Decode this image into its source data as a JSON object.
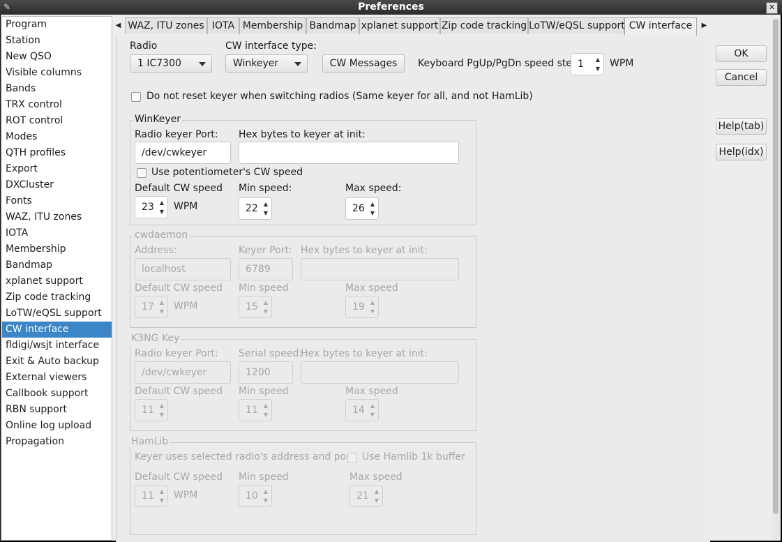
{
  "window": {
    "title": "Preferences",
    "close_glyph": "✕",
    "app_icon": "feather-icon"
  },
  "sidebar": {
    "items": [
      {
        "label": "Program"
      },
      {
        "label": "Station"
      },
      {
        "label": "New QSO"
      },
      {
        "label": "Visible columns"
      },
      {
        "label": "Bands"
      },
      {
        "label": "TRX control"
      },
      {
        "label": "ROT control"
      },
      {
        "label": "Modes"
      },
      {
        "label": "QTH profiles"
      },
      {
        "label": "Export"
      },
      {
        "label": "DXCluster"
      },
      {
        "label": "Fonts"
      },
      {
        "label": "WAZ, ITU zones"
      },
      {
        "label": "IOTA"
      },
      {
        "label": "Membership"
      },
      {
        "label": "Bandmap"
      },
      {
        "label": "xplanet support"
      },
      {
        "label": "Zip code tracking"
      },
      {
        "label": "LoTW/eQSL support"
      },
      {
        "label": "CW interface"
      },
      {
        "label": "fldigi/wsjt interface"
      },
      {
        "label": "Exit & Auto backup"
      },
      {
        "label": "External viewers"
      },
      {
        "label": "Callbook support"
      },
      {
        "label": "RBN support"
      },
      {
        "label": "Online log upload"
      },
      {
        "label": "Propagation"
      }
    ],
    "selected": "CW interface"
  },
  "tabs": {
    "items": [
      {
        "label": "WAZ, ITU zones"
      },
      {
        "label": "IOTA"
      },
      {
        "label": "Membership"
      },
      {
        "label": "Bandmap"
      },
      {
        "label": "xplanet support"
      },
      {
        "label": "Zip code tracking"
      },
      {
        "label": "LoTW/eQSL support"
      },
      {
        "label": "CW interface"
      }
    ],
    "active": "CW interface",
    "left_arrow": "◀",
    "right_arrow": "▶"
  },
  "cw": {
    "radio_label": "Radio",
    "radio_value": "1 IC7300",
    "type_label": "CW interface type:",
    "type_value": "Winkeyer",
    "messages_button": "CW Messages",
    "speed_step_label": "Keyboard PgUp/PgDn speed step",
    "speed_step_value": "1",
    "speed_step_unit": "WPM",
    "no_reset_label": "Do not reset keyer when switching radios (Same keyer for all, and not HamLib)",
    "no_reset_checked": false
  },
  "winkeyer": {
    "title": "WinKeyer",
    "port_label": "Radio keyer Port:",
    "port_value": "/dev/cwkeyer",
    "hex_label": "Hex bytes to keyer at init:",
    "hex_value": "",
    "pot_label": "Use potentiometer's CW speed",
    "pot_checked": false,
    "default_label": "Default CW speed",
    "default_value": "23",
    "unit": "WPM",
    "min_label": "Min speed:",
    "min_value": "22",
    "max_label": "Max speed:",
    "max_value": "26"
  },
  "cwdaemon": {
    "title": "cwdaemon",
    "address_label": "Address:",
    "address_value": "localhost",
    "port_label": "Keyer Port:",
    "port_value": "6789",
    "hex_label": "Hex bytes to keyer at init:",
    "default_label": "Default CW speed",
    "default_value": "17",
    "unit": "WPM",
    "min_label": "Min speed",
    "min_value": "15",
    "max_label": "Max speed",
    "max_value": "19"
  },
  "k3ng": {
    "title": "K3NG Key",
    "port_label": "Radio keyer Port:",
    "port_value": "/dev/cwkeyer",
    "serial_label": "Serial speed:",
    "serial_value": "1200",
    "hex_label": "Hex bytes to keyer at init:",
    "default_label": "Default CW speed",
    "default_value": "11",
    "min_label": "Min speed",
    "min_value": "11",
    "max_label": "Max speed",
    "max_value": "14"
  },
  "hamlib": {
    "title": "HamLib",
    "uses_label": "Keyer uses selected radio's address and port",
    "buffer_label": "Use Hamlib 1k buffer",
    "default_label": "Default CW speed",
    "default_value": "11",
    "unit": "WPM",
    "min_label": "Min speed",
    "min_value": "10",
    "max_label": "Max speed",
    "max_value": "21"
  },
  "buttons": {
    "ok": "OK",
    "cancel": "Cancel",
    "help_tab": "Help(tab)",
    "help_idx": "Help(idx)"
  },
  "glyphs": {
    "up": "▲",
    "down": "▼"
  }
}
